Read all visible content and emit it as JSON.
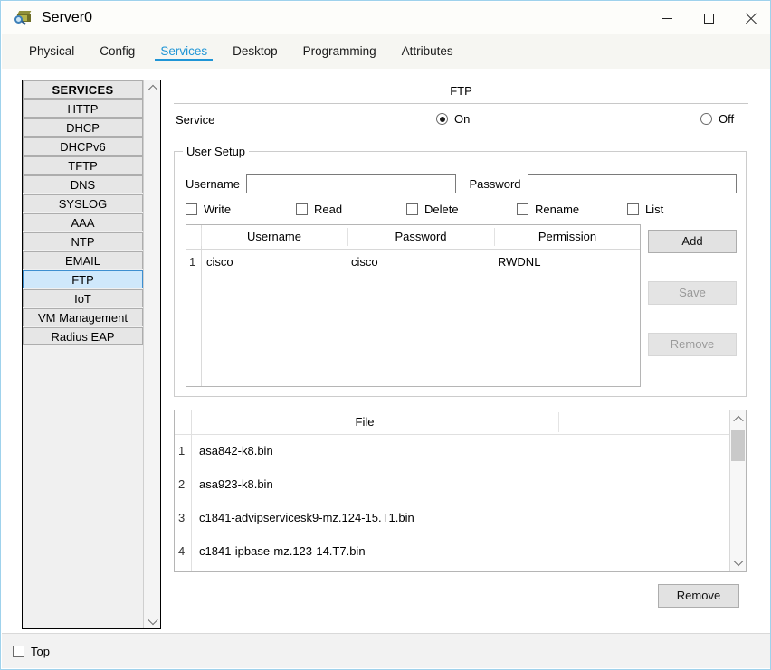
{
  "window": {
    "title": "Server0",
    "icon": "server-magnifier-icon",
    "controls": {
      "minimize": "minimize-icon",
      "maximize": "maximize-icon",
      "close": "close-icon"
    }
  },
  "tabs": [
    {
      "label": "Physical",
      "active": false
    },
    {
      "label": "Config",
      "active": false
    },
    {
      "label": "Services",
      "active": true
    },
    {
      "label": "Desktop",
      "active": false
    },
    {
      "label": "Programming",
      "active": false
    },
    {
      "label": "Attributes",
      "active": false
    }
  ],
  "sidebar": {
    "header": "SERVICES",
    "items": [
      {
        "label": "HTTP",
        "selected": false
      },
      {
        "label": "DHCP",
        "selected": false
      },
      {
        "label": "DHCPv6",
        "selected": false
      },
      {
        "label": "TFTP",
        "selected": false
      },
      {
        "label": "DNS",
        "selected": false
      },
      {
        "label": "SYSLOG",
        "selected": false
      },
      {
        "label": "AAA",
        "selected": false
      },
      {
        "label": "NTP",
        "selected": false
      },
      {
        "label": "EMAIL",
        "selected": false
      },
      {
        "label": "FTP",
        "selected": true
      },
      {
        "label": "IoT",
        "selected": false
      },
      {
        "label": "VM Management",
        "selected": false
      },
      {
        "label": "Radius EAP",
        "selected": false
      }
    ]
  },
  "panel": {
    "title": "FTP",
    "service": {
      "label": "Service",
      "on_label": "On",
      "off_label": "Off",
      "selected": "On"
    },
    "user_setup": {
      "legend": "User Setup",
      "username_label": "Username",
      "username_value": "",
      "username_placeholder": "",
      "password_label": "Password",
      "password_value": "",
      "password_placeholder": "",
      "permissions": [
        {
          "label": "Write",
          "checked": false
        },
        {
          "label": "Read",
          "checked": false
        },
        {
          "label": "Delete",
          "checked": false
        },
        {
          "label": "Rename",
          "checked": false
        },
        {
          "label": "List",
          "checked": false
        }
      ],
      "table": {
        "columns": [
          "Username",
          "Password",
          "Permission"
        ],
        "rows": [
          {
            "index": "1",
            "username": "cisco",
            "password": "cisco",
            "permission": "RWDNL"
          }
        ]
      },
      "buttons": {
        "add": {
          "label": "Add",
          "enabled": true
        },
        "save": {
          "label": "Save",
          "enabled": false
        },
        "remove": {
          "label": "Remove",
          "enabled": false
        }
      }
    },
    "file_list": {
      "column": "File",
      "rows": [
        {
          "index": "1",
          "name": "asa842-k8.bin"
        },
        {
          "index": "2",
          "name": "asa923-k8.bin"
        },
        {
          "index": "3",
          "name": "c1841-advipservicesk9-mz.124-15.T1.bin"
        },
        {
          "index": "4",
          "name": "c1841-ipbase-mz.123-14.T7.bin"
        }
      ],
      "remove_button": "Remove"
    }
  },
  "bottom": {
    "top_checkbox": {
      "label": "Top",
      "checked": false
    }
  },
  "colors": {
    "accent": "#1f95d6",
    "selection": "#cfe8fb",
    "selection_border": "#3e8fd0",
    "window_border": "#9fd2ec",
    "button_face": "#e2e2e2",
    "disabled_text": "#9a9a9a"
  }
}
